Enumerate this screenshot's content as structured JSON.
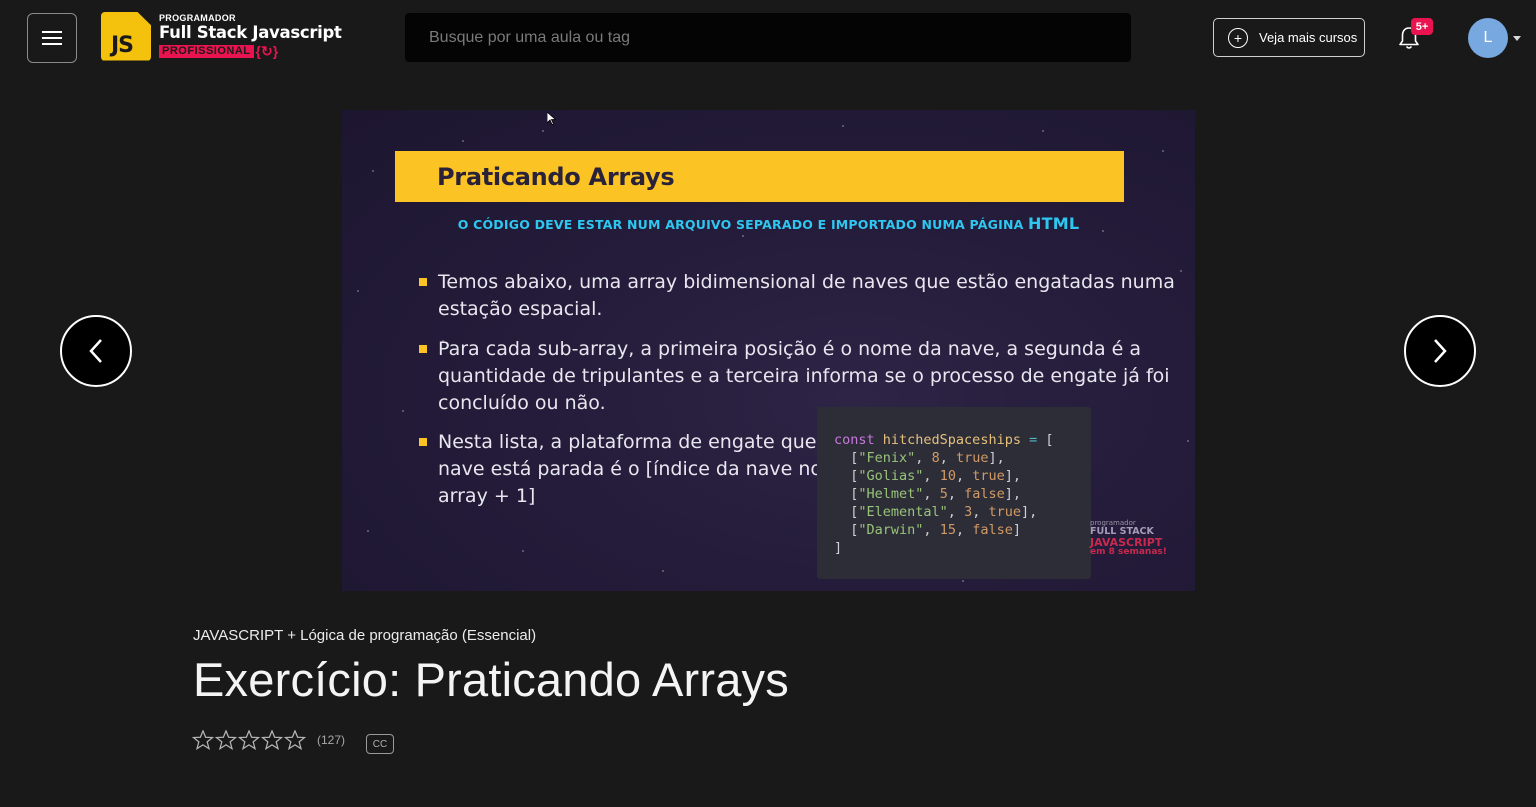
{
  "header": {
    "menu_icon": "hamburger-menu-icon",
    "logo": {
      "badge_text": "JS",
      "small": "PROGRAMADOR",
      "big": "Full Stack Javascript",
      "pro": "PROFISSIONAL",
      "brace": "{↻}"
    },
    "search_placeholder": "Busque por uma aula ou tag",
    "more_courses_label": "Veja mais cursos",
    "notifications_badge": "5+",
    "avatar_initial": "L"
  },
  "slide": {
    "title": "Praticando Arrays",
    "subtitle_main": "O CÓDIGO DEVE ESTAR NUM ARQUIVO SEPARADO E IMPORTADO NUMA PÁGINA ",
    "subtitle_highlight": "HTML",
    "bullets": [
      "Temos abaixo, uma array bidimensional de naves que estão engatadas numa estação espacial.",
      "Para cada sub-array, a primeira posição é o nome da nave, a segunda é a quantidade de tripulantes e a terceira informa se o processo de engate já foi concluído ou não.",
      "Nesta lista, a plataforma de engate que a nave está parada é o [índice da nave no array + 1]"
    ],
    "code": {
      "declaration_kw": "const",
      "declaration_name": "hitchedSpaceships",
      "declaration_op": "=",
      "open": "[",
      "close": "]",
      "rows": [
        {
          "name": "\"Fenix\"",
          "crew": "8",
          "done": "true"
        },
        {
          "name": "\"Golias\"",
          "crew": "10",
          "done": "true"
        },
        {
          "name": "\"Helmet\"",
          "crew": "5",
          "done": "false"
        },
        {
          "name": "\"Elemental\"",
          "crew": "3",
          "done": "true"
        },
        {
          "name": "\"Darwin\"",
          "crew": "15",
          "done": "false"
        }
      ]
    },
    "watermark": {
      "small": "programador",
      "mid": "FULL STACK",
      "js": "JAVASCRIPT",
      "weeks": "em 8 semanas!"
    }
  },
  "lesson": {
    "course_name": "JAVASCRIPT + Lógica de programação (Essencial)",
    "title": "Exercício: Praticando Arrays",
    "rating_stars": 5,
    "rating_count": "(127)",
    "cc_label": "CC"
  }
}
